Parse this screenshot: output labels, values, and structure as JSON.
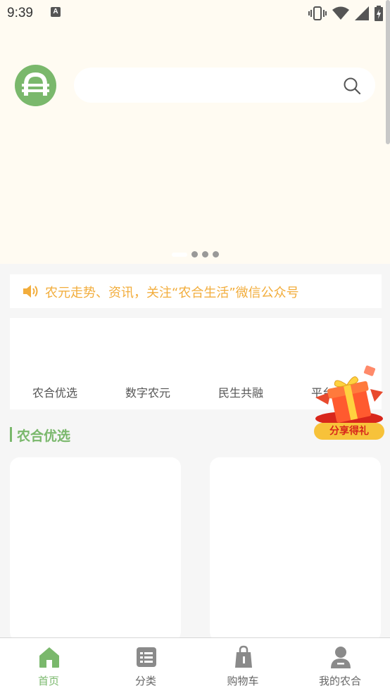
{
  "status_bar": {
    "time": "9:39",
    "notification_badge": "A"
  },
  "header": {
    "logo_icon": "app-logo-icon",
    "search": {
      "placeholder": "",
      "icon": "search-icon"
    }
  },
  "banner": {
    "carousel_dots": 4,
    "active_index": 0
  },
  "notice": {
    "icon": "speaker-icon",
    "text": "农元走势、资讯，关注“农合生活”微信公众号",
    "color": "#f2ad3c"
  },
  "categories": [
    {
      "label": "农合优选"
    },
    {
      "label": "数字农元"
    },
    {
      "label": "民生共融"
    },
    {
      "label": "平台公告"
    }
  ],
  "floating_promo": {
    "label": "分享得礼",
    "icon": "gift-box-icon"
  },
  "section": {
    "title": "农合优选",
    "accent": "#7ab86c"
  },
  "tabbar": {
    "items": [
      {
        "label": "首页",
        "icon": "home-icon",
        "active": true
      },
      {
        "label": "分类",
        "icon": "category-icon",
        "active": false
      },
      {
        "label": "购物车",
        "icon": "shopping-bag-icon",
        "active": false
      },
      {
        "label": "我的农合",
        "icon": "user-icon",
        "active": false
      }
    ]
  }
}
